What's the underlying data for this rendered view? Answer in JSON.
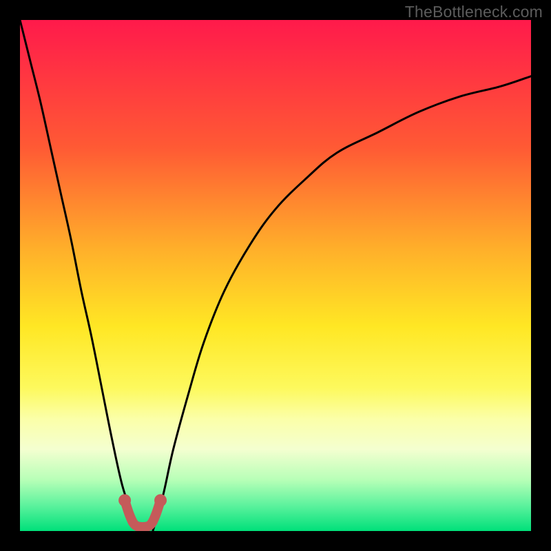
{
  "watermark": "TheBottleneck.com",
  "chart_data": {
    "type": "line",
    "title": "",
    "xlabel": "",
    "ylabel": "",
    "xlim": [
      0,
      100
    ],
    "ylim": [
      0,
      100
    ],
    "gradient_stops": [
      {
        "offset": 0,
        "color": "#ff1a4b"
      },
      {
        "offset": 25,
        "color": "#ff5a34"
      },
      {
        "offset": 45,
        "color": "#ffb02a"
      },
      {
        "offset": 60,
        "color": "#ffe724"
      },
      {
        "offset": 72,
        "color": "#fdf95d"
      },
      {
        "offset": 78,
        "color": "#fbffa8"
      },
      {
        "offset": 84,
        "color": "#f4ffd0"
      },
      {
        "offset": 90,
        "color": "#b7ffb7"
      },
      {
        "offset": 95,
        "color": "#5cf29d"
      },
      {
        "offset": 100,
        "color": "#00e07a"
      }
    ],
    "series": [
      {
        "name": "left-curve",
        "x": [
          0,
          2,
          4,
          6,
          8,
          10,
          12,
          14,
          16,
          18,
          20,
          22,
          23
        ],
        "y": [
          100,
          92,
          84,
          75,
          66,
          57,
          47,
          38,
          28,
          18,
          9,
          3,
          0
        ]
      },
      {
        "name": "right-curve",
        "x": [
          26,
          28,
          30,
          33,
          36,
          40,
          45,
          50,
          56,
          62,
          70,
          78,
          86,
          94,
          100
        ],
        "y": [
          0,
          7,
          16,
          27,
          37,
          47,
          56,
          63,
          69,
          74,
          78,
          82,
          85,
          87,
          89
        ]
      },
      {
        "name": "marker-band",
        "x": [
          20.5,
          21.5,
          22.5,
          24,
          25.5,
          26.5,
          27.5
        ],
        "y": [
          6,
          3,
          1.2,
          0.8,
          1.2,
          3,
          6
        ]
      }
    ],
    "marker_color": "#c55a5a",
    "curve_color": "#000000"
  }
}
